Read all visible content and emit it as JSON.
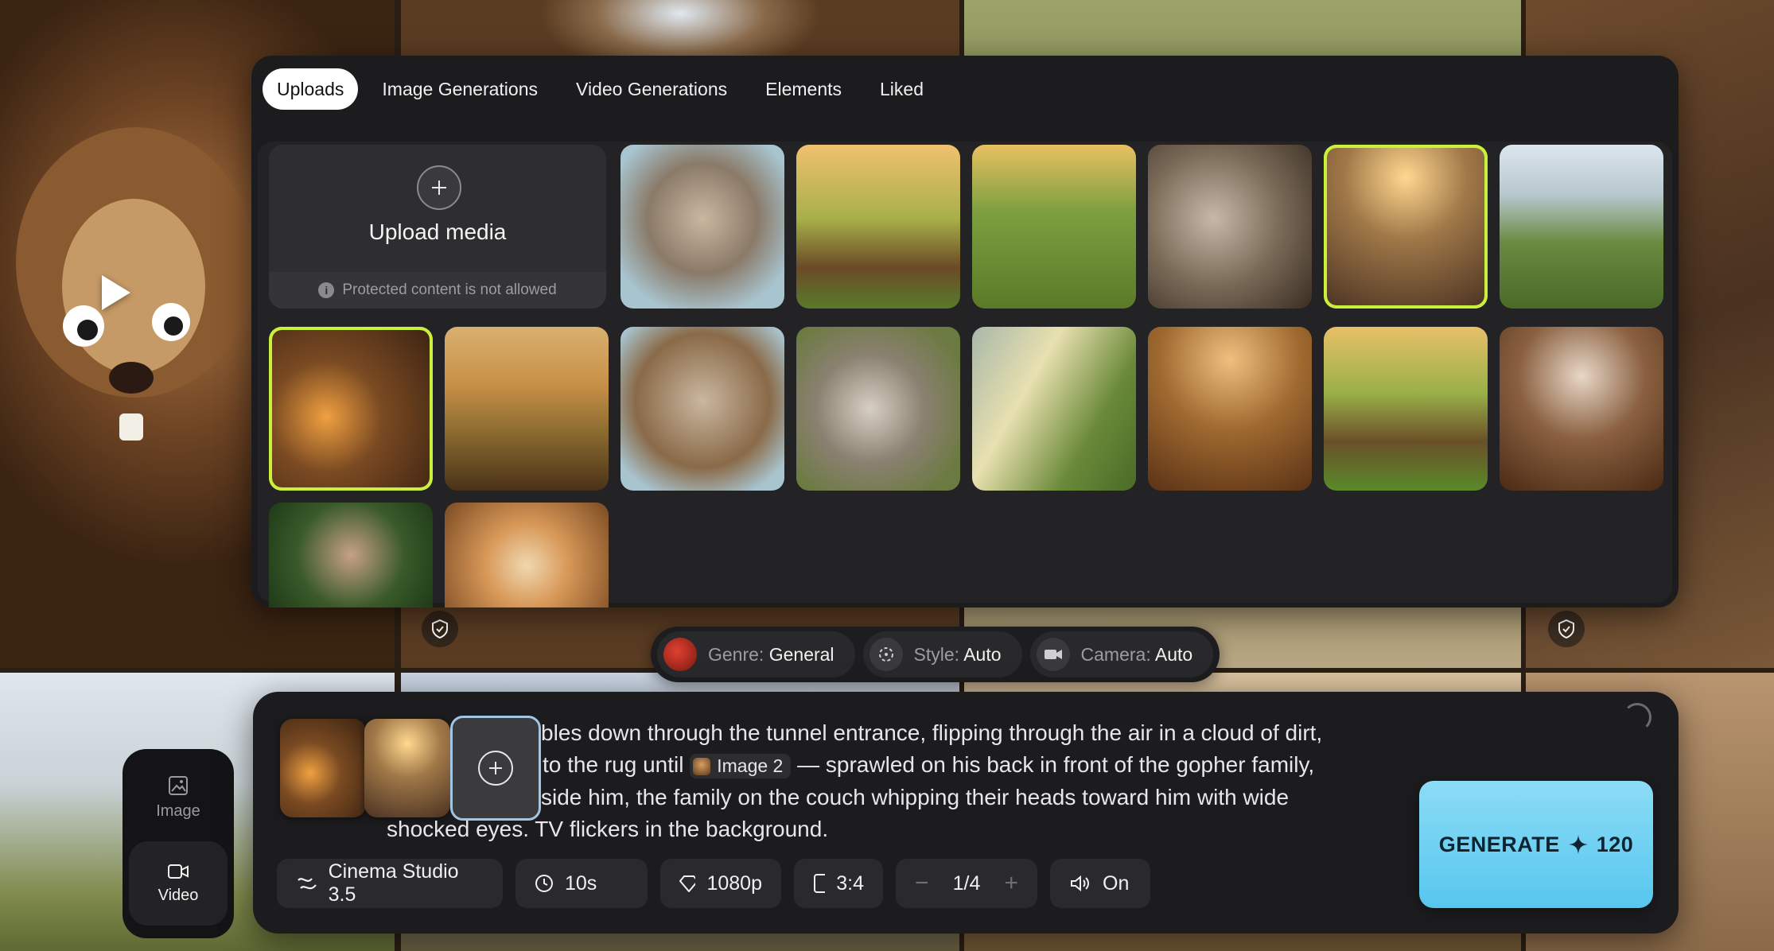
{
  "tabs": [
    {
      "label": "Uploads",
      "active": true
    },
    {
      "label": "Image Generations",
      "active": false
    },
    {
      "label": "Video Generations",
      "active": false
    },
    {
      "label": "Elements",
      "active": false
    },
    {
      "label": "Liked",
      "active": false
    }
  ],
  "upload": {
    "title": "Upload media",
    "note": "Protected content is not allowed",
    "icon": "plus-icon"
  },
  "gallery": {
    "selected_count": 2,
    "item_count": 17
  },
  "options": {
    "genre": {
      "key": "Genre:",
      "value": "General"
    },
    "style": {
      "key": "Style:",
      "value": "Auto"
    },
    "camera": {
      "key": "Camera:",
      "value": "Auto"
    }
  },
  "mode": {
    "image_label": "Image",
    "video_label": "Video",
    "active": "Video"
  },
  "prompt": {
    "line1": "bles down through the tunnel entrance, flipping through the air in a cloud of dirt,",
    "line2_before": "to the rug until",
    "tag_label": "Image 2",
    "line2_after": "— sprawled on his back in front of the gopher family,",
    "line3": "side him, the family on the couch whipping their heads toward him with wide",
    "line4": "shocked eyes. TV flickers in the background."
  },
  "controls": {
    "model": "Cinema Studio 3.5",
    "duration": "10s",
    "resolution": "1080p",
    "aspect": "3:4",
    "count": "1/4",
    "count_minus": "−",
    "count_plus": "+",
    "audio": "On"
  },
  "generate": {
    "label": "GENERATE",
    "cost": "120"
  },
  "colors": {
    "accent_selected": "#c8f03c",
    "generate_bg": "#57c6ee",
    "panel_bg": "#1c1c1e"
  }
}
